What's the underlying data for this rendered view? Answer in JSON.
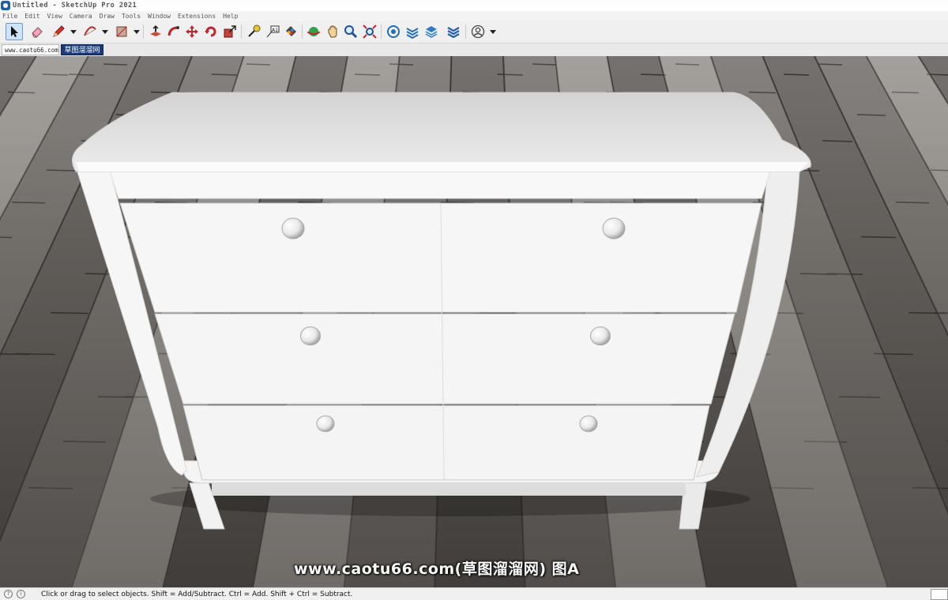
{
  "window": {
    "title": "Untitled - SketchUp Pro 2021"
  },
  "menu": [
    "File",
    "Edit",
    "View",
    "Camera",
    "Draw",
    "Tools",
    "Window",
    "Extensions",
    "Help"
  ],
  "toolbar": {
    "tools": [
      {
        "name": "select-tool",
        "icon": "arrow-cursor-icon",
        "active": true
      },
      {
        "name": "eraser-tool",
        "icon": "eraser-icon"
      },
      {
        "name": "line-tool",
        "icon": "pencil-icon",
        "dropdown": true
      },
      {
        "name": "arc-tool",
        "icon": "arc-icon",
        "dropdown": true
      },
      {
        "name": "rectangle-tool",
        "icon": "rectangle-icon",
        "dropdown": true
      },
      {
        "name": "push-pull-tool",
        "icon": "push-pull-icon"
      },
      {
        "name": "follow-me-tool",
        "icon": "follow-me-icon"
      },
      {
        "name": "move-tool",
        "icon": "move-icon"
      },
      {
        "name": "rotate-tool",
        "icon": "rotate-icon"
      },
      {
        "name": "scale-tool",
        "icon": "scale-icon"
      },
      {
        "name": "tape-measure-tool",
        "icon": "tape-measure-icon"
      },
      {
        "name": "text-tool",
        "icon": "text-icon"
      },
      {
        "name": "paint-bucket-tool",
        "icon": "paint-bucket-icon"
      },
      {
        "name": "orbit-tool",
        "icon": "orbit-icon"
      },
      {
        "name": "pan-tool",
        "icon": "pan-hand-icon"
      },
      {
        "name": "zoom-tool",
        "icon": "zoom-icon"
      },
      {
        "name": "zoom-extents-tool",
        "icon": "zoom-extents-icon"
      },
      {
        "name": "3d-warehouse-tool",
        "icon": "warehouse-icon"
      },
      {
        "name": "extension-warehouse-tool",
        "icon": "extension-warehouse-icon"
      },
      {
        "name": "layout-tool",
        "icon": "layers-icon"
      },
      {
        "name": "extension-manager-tool",
        "icon": "extension-manager-icon"
      },
      {
        "name": "account-tool",
        "icon": "user-account-icon",
        "dropdown": true
      }
    ]
  },
  "scene_tabs": [
    "www.caotu66.com",
    "草图溜溜网"
  ],
  "viewport": {
    "model": "three-drawer-chest",
    "watermark": "www.caotu66.com(草图溜溜网) 图A"
  },
  "status": {
    "message": "Click or drag to select objects. Shift = Add/Subtract. Ctrl = Add. Shift + Ctrl = Subtract."
  },
  "colors": {
    "floor_dark": "#3d3a37",
    "floor_light": "#8c8986",
    "furniture": "#f4f4f4",
    "tab_active": "#1b3a7a"
  }
}
